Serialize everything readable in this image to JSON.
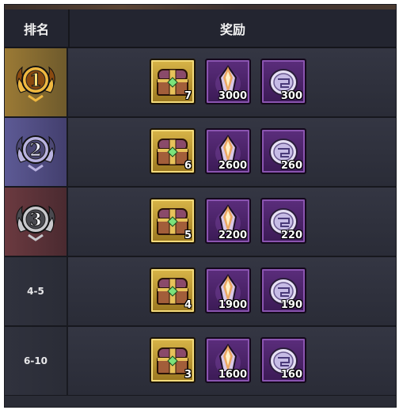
{
  "header": {
    "rank_label": "排名",
    "reward_label": "奖励"
  },
  "rows": [
    {
      "rank": "1",
      "rank_style": "gold-medal",
      "rewards": [
        {
          "item": "treasure-chest",
          "qty": "7"
        },
        {
          "item": "crystal-shard",
          "qty": "3000"
        },
        {
          "item": "silver-coin",
          "qty": "300"
        }
      ]
    },
    {
      "rank": "2",
      "rank_style": "silver-medal",
      "rewards": [
        {
          "item": "treasure-chest",
          "qty": "6"
        },
        {
          "item": "crystal-shard",
          "qty": "2600"
        },
        {
          "item": "silver-coin",
          "qty": "260"
        }
      ]
    },
    {
      "rank": "3",
      "rank_style": "bronze-medal",
      "rewards": [
        {
          "item": "treasure-chest",
          "qty": "5"
        },
        {
          "item": "crystal-shard",
          "qty": "2200"
        },
        {
          "item": "silver-coin",
          "qty": "220"
        }
      ]
    },
    {
      "rank": "4-5",
      "rank_style": "text",
      "rewards": [
        {
          "item": "treasure-chest",
          "qty": "4"
        },
        {
          "item": "crystal-shard",
          "qty": "1900"
        },
        {
          "item": "silver-coin",
          "qty": "190"
        }
      ]
    },
    {
      "rank": "6-10",
      "rank_style": "text",
      "rewards": [
        {
          "item": "treasure-chest",
          "qty": "3"
        },
        {
          "item": "crystal-shard",
          "qty": "1600"
        },
        {
          "item": "silver-coin",
          "qty": "160"
        }
      ]
    }
  ],
  "colors": {
    "gold_row": "#7a6530",
    "silver_row": "#4e4a7c",
    "bronze_row": "#5a3238",
    "plain_row": "#2d2f3a",
    "gold_frame": "#d8b548",
    "purple_frame": "#5b2d7c"
  }
}
